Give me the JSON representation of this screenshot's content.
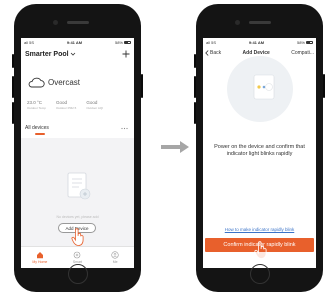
{
  "colors": {
    "accent": "#e8602c",
    "link": "#3a73c8",
    "background": "#f3f3f5",
    "frame": "#141414"
  },
  "left_phone": {
    "status_bar": {
      "carrier": "all 5S",
      "time": "9:41 AM",
      "battery": "58%"
    },
    "header": {
      "title": "Smarter Pool",
      "title_icon": "chevron-down-icon",
      "add_icon": "plus-icon"
    },
    "weather": {
      "icon": "cloud-icon",
      "condition": "Overcast"
    },
    "stats": [
      {
        "value": "23.0 °C",
        "label": "Outdoor Temp"
      },
      {
        "value": "Good",
        "label": "Outdoor PM2.5"
      },
      {
        "value": "Good",
        "label": "Outdoor AQI"
      }
    ],
    "section": {
      "label": "All devices",
      "more_icon": "ellipsis-icon"
    },
    "empty_state": {
      "icon": "document-icon",
      "message": "No devices yet, please add",
      "button": "Add Device"
    },
    "tabbar": [
      {
        "label": "My Home",
        "icon": "home-icon",
        "active": true
      },
      {
        "label": "Smart",
        "icon": "sparkle-icon",
        "active": false
      },
      {
        "label": "Me",
        "icon": "user-icon",
        "active": false
      }
    ]
  },
  "right_phone": {
    "status_bar": {
      "carrier": "all 5S",
      "time": "9:41 AM",
      "battery": "58%"
    },
    "nav": {
      "back": "Back",
      "title": "Add Device",
      "right": "Compati..."
    },
    "instruction": "Power on the device and confirm that indicator light blinks rapidly",
    "help_link": "How to make indicator rapidly blink",
    "confirm_button": "Confirm indicator rapidly blink"
  }
}
